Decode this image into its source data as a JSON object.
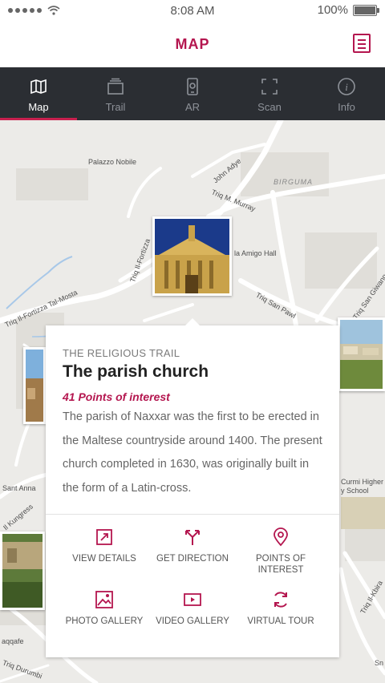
{
  "status_bar": {
    "time": "8:08 AM",
    "battery": "100%",
    "battery_level": 1.0
  },
  "header": {
    "title": "MAP",
    "menu_icon": "list-icon"
  },
  "tabs": [
    {
      "label": "Map",
      "icon": "map-icon",
      "active": true
    },
    {
      "label": "Trail",
      "icon": "trail-icon",
      "active": false
    },
    {
      "label": "AR",
      "icon": "ar-icon",
      "active": false
    },
    {
      "label": "Scan",
      "icon": "scan-icon",
      "active": false
    },
    {
      "label": "Info",
      "icon": "info-icon",
      "active": false
    }
  ],
  "map": {
    "labels": [
      "Palazzo Nobile",
      "John Adye",
      "BIRGUMA",
      "Triq M. Murray",
      "Triq Il-Fortizza",
      "la Amigo Hall",
      "Triq Il-Fortizza Tal-Mosta",
      "Triq San Pawl",
      "Triq San Giwann",
      "Sant Anna",
      "Il Kungress",
      "Curmi Higher",
      "y School",
      "Triq Il-Kbira",
      "Sn",
      "aqqafe",
      "Triq Durumbi"
    ]
  },
  "card": {
    "trail_name": "THE RELIGIOUS TRAIL",
    "title": "The parish church",
    "points_of_interest": "41 Points of interest",
    "description": "The parish of Naxxar was the first to be erected in the Maltese countryside around 1400. The present church completed in 1630, was originally built in the form of a Latin-cross.",
    "actions": [
      {
        "label": "VIEW DETAILS",
        "icon": "view-details-icon"
      },
      {
        "label": "GET DIRECTION",
        "icon": "direction-icon"
      },
      {
        "label": "POINTS OF INTEREST",
        "icon": "location-pin-icon"
      },
      {
        "label": "PHOTO GALLERY",
        "icon": "photo-gallery-icon"
      },
      {
        "label": "VIDEO GALLERY",
        "icon": "video-gallery-icon"
      },
      {
        "label": "VIRTUAL TOUR",
        "icon": "virtual-tour-icon"
      }
    ]
  },
  "colors": {
    "accent": "#b4164f",
    "tabbar": "#2b2e33",
    "map_bg": "#ecebe8"
  }
}
